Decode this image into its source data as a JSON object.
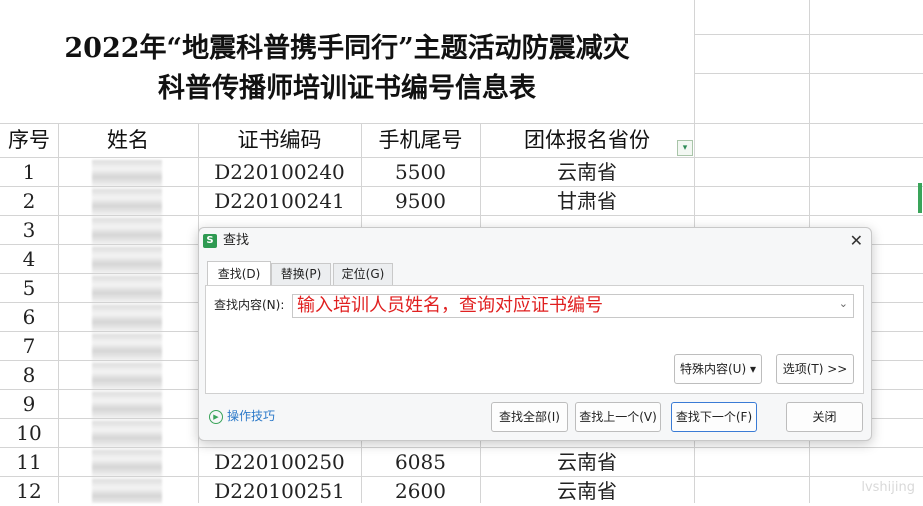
{
  "sheet": {
    "title_line1": "2022年“地震科普携手同行”主题活动防震减灾",
    "title_line2": "科普传播师培训证书编号信息表",
    "columns": [
      "序号",
      "姓名",
      "证书编码",
      "手机尾号",
      "团体报名省份"
    ],
    "rows": [
      {
        "no": "1",
        "cert": "D220100240",
        "phone": "5500",
        "prov": "云南省"
      },
      {
        "no": "2",
        "cert": "D220100241",
        "phone": "9500",
        "prov": "甘肃省"
      },
      {
        "no": "3",
        "cert": "",
        "phone": "",
        "prov": ""
      },
      {
        "no": "4",
        "cert": "",
        "phone": "",
        "prov": ""
      },
      {
        "no": "5",
        "cert": "",
        "phone": "",
        "prov": ""
      },
      {
        "no": "6",
        "cert": "",
        "phone": "",
        "prov": ""
      },
      {
        "no": "7",
        "cert": "",
        "phone": "",
        "prov": ""
      },
      {
        "no": "8",
        "cert": "",
        "phone": "",
        "prov": ""
      },
      {
        "no": "9",
        "cert": "",
        "phone": "",
        "prov": ""
      },
      {
        "no": "10",
        "cert": "",
        "phone": "",
        "prov": ""
      },
      {
        "no": "11",
        "cert": "D220100250",
        "phone": "6085",
        "prov": "云南省"
      },
      {
        "no": "12",
        "cert": "D220100251",
        "phone": "2600",
        "prov": "云南省"
      }
    ],
    "filter_icon": "dropdown-filter-icon",
    "watermark": "lvshijing"
  },
  "dialog": {
    "title": "查找",
    "logo": "S",
    "close_glyph": "✕",
    "tabs": [
      "查找(D)",
      "替换(P)",
      "定位(G)"
    ],
    "find_label": "查找内容(N):",
    "find_value": "输入培训人员姓名，查询对应证书编号",
    "special_button": "特殊内容(U) ▾",
    "options_button": "选项(T) >>",
    "tips_link": "操作技巧",
    "buttons": {
      "find_all": "查找全部(I)",
      "find_prev": "查找上一个(V)",
      "find_next": "查找下一个(F)",
      "close": "关闭"
    },
    "accent_color": "#3a7bd5"
  }
}
